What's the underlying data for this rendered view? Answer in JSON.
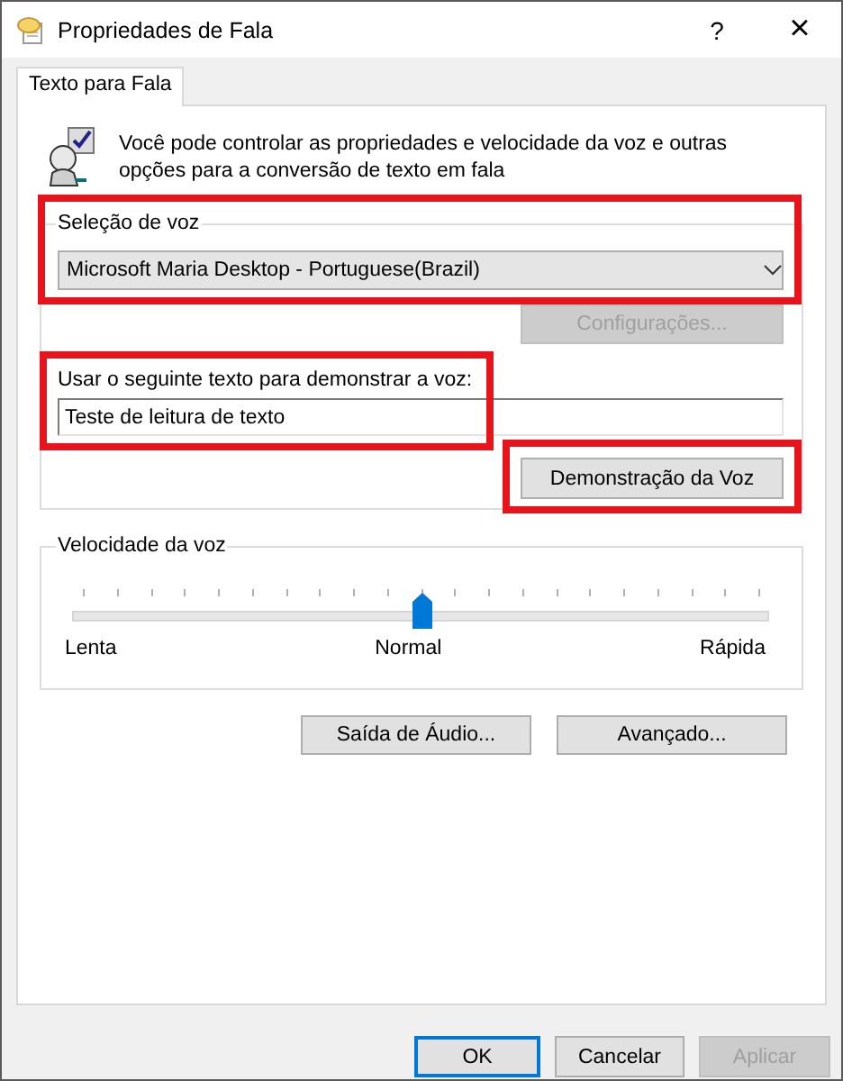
{
  "window": {
    "title": "Propriedades de Fala",
    "help": "?",
    "close": "×"
  },
  "tabs": [
    {
      "label": "Texto para Fala",
      "selected": true
    }
  ],
  "intro": {
    "text": "Você pode controlar as propriedades e velocidade da voz e outras opções para a conversão de texto em fala"
  },
  "voice_selection": {
    "label": "Seleção de voz",
    "value": "Microsoft Maria Desktop - Portuguese(Brazil)",
    "highlighted": true,
    "settings_button": {
      "label": "Configurações...",
      "disabled": true
    }
  },
  "demo_text": {
    "label": "Usar o seguinte texto para demonstrar a voz:",
    "value": "Teste de leitura de texto",
    "highlighted": true
  },
  "demo_button": {
    "label": "Demonstração da Voz",
    "highlighted": true
  },
  "speed": {
    "label": "Velocidade da voz",
    "level": 0.5,
    "min_label": "Lenta",
    "mid_label": "Normal",
    "max_label": "Rápida"
  },
  "panel_buttons": [
    {
      "label": "Saída de Áudio...",
      "disabled": false
    },
    {
      "label": "Avançado...",
      "disabled": false
    }
  ],
  "footer_buttons": [
    {
      "label": "OK",
      "default": true,
      "disabled": false
    },
    {
      "label": "Cancelar",
      "default": false,
      "disabled": false
    },
    {
      "label": "Aplicar",
      "default": false,
      "disabled": true
    }
  ]
}
